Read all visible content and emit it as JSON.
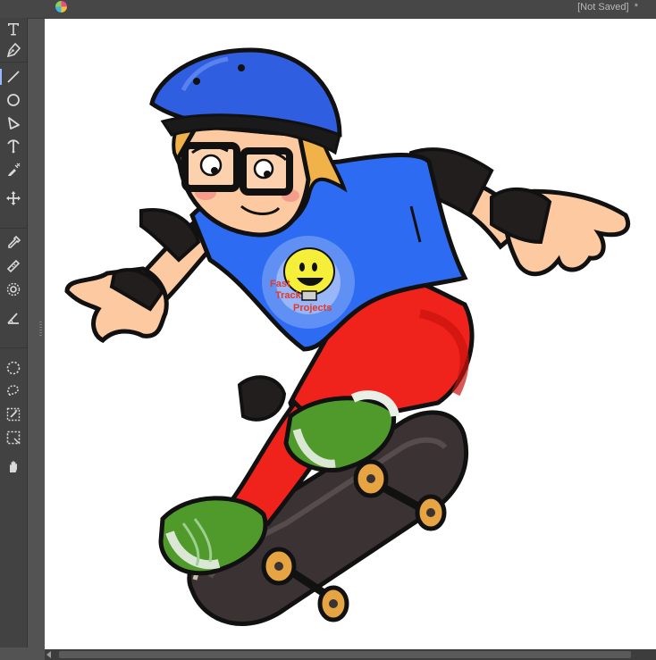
{
  "window": {
    "status": "[Not Saved]  *"
  },
  "toolbar": {
    "tools": [
      {
        "name": "text-tool",
        "icon": "text-icon"
      },
      {
        "name": "pen-tool",
        "icon": "pen-nib-icon"
      },
      {
        "name": "line-tool",
        "icon": "line-icon",
        "active": true
      },
      {
        "name": "ellipse-tool",
        "icon": "circle-icon"
      },
      {
        "name": "polygon-tool",
        "icon": "polygon-icon"
      },
      {
        "name": "curve-tool",
        "icon": "curve-icon"
      },
      {
        "name": "brush-tool",
        "icon": "spray-brush-icon"
      },
      {
        "name": "move-tool",
        "icon": "move-arrows-icon"
      },
      {
        "name": "eyedropper-tool",
        "icon": "eyedropper-icon"
      },
      {
        "name": "heal-tool",
        "icon": "bandage-icon"
      },
      {
        "name": "spot-tool",
        "icon": "dotted-circle-target-icon"
      },
      {
        "name": "measure-tool",
        "icon": "angle-ruler-icon"
      },
      {
        "name": "ellipse-select-tool",
        "icon": "dashed-circle-icon"
      },
      {
        "name": "lasso-select-tool",
        "icon": "lasso-icon"
      },
      {
        "name": "magic-select-tool",
        "icon": "magic-select-icon"
      },
      {
        "name": "rect-select-tool",
        "icon": "dashed-rect-icon"
      },
      {
        "name": "hand-tool",
        "icon": "hand-icon"
      }
    ]
  },
  "canvas": {
    "background": "#ffffff",
    "artwork": "skateboarder-illustration",
    "shirt_logo_lines": [
      "Fast",
      "Track",
      "Projects"
    ]
  },
  "colors": {
    "helmet": "#2f5fe0",
    "shirt": "#2d6bf2",
    "pants": "#f0231c",
    "skin": "#fcc9a0",
    "hair": "#f1b24a",
    "shoe": "#4f9a2b",
    "deck": "#3b3233",
    "wheels": "#e6a542"
  }
}
